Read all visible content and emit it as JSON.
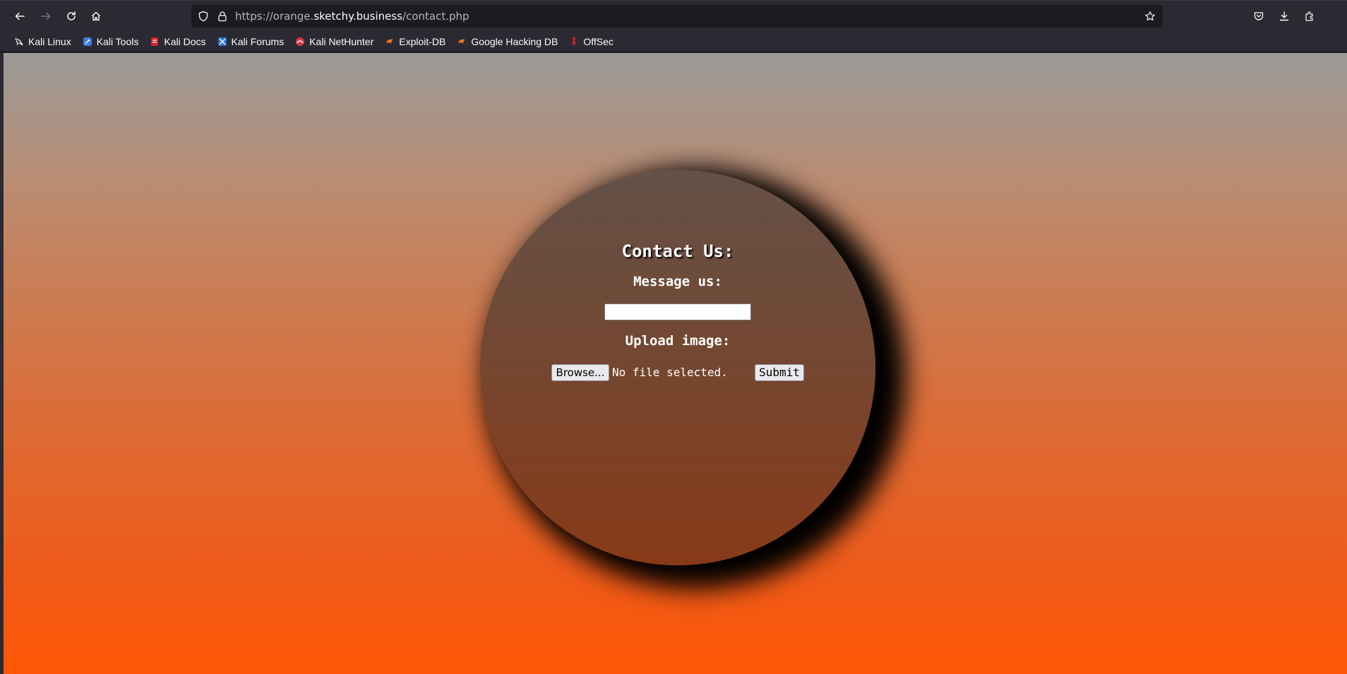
{
  "browser": {
    "url_prefix": "https://orange.",
    "url_host": "sketchy.business",
    "url_path": "/contact.php",
    "icons": [
      "back-arrow-icon",
      "forward-arrow-icon",
      "reload-icon",
      "home-icon",
      "shield-icon",
      "lock-icon",
      "star-icon",
      "pocket-icon",
      "download-icon",
      "extensions-icon"
    ]
  },
  "bookmarks": [
    {
      "label": "Kali Linux",
      "icon": "kali-dragon-icon"
    },
    {
      "label": "Kali Tools",
      "icon": "kali-tools-icon"
    },
    {
      "label": "Kali Docs",
      "icon": "kali-docs-icon"
    },
    {
      "label": "Kali Forums",
      "icon": "kali-forums-icon"
    },
    {
      "label": "Kali NetHunter",
      "icon": "nethunter-icon"
    },
    {
      "label": "Exploit-DB",
      "icon": "exploit-db-icon"
    },
    {
      "label": "Google Hacking DB",
      "icon": "ghdb-icon"
    },
    {
      "label": "OffSec",
      "icon": "offsec-icon"
    }
  ],
  "page": {
    "heading": "Contact Us:",
    "message_label": "Message us:",
    "message_value": "",
    "upload_label": "Upload image:",
    "browse_label": "Browse...",
    "file_status": "No file selected.",
    "submit_label": "Submit"
  },
  "colors": {
    "gradient_top": "#9b9a99",
    "gradient_bottom": "#fe5604",
    "circle_top": "#645148",
    "circle_bottom": "#873a18"
  }
}
